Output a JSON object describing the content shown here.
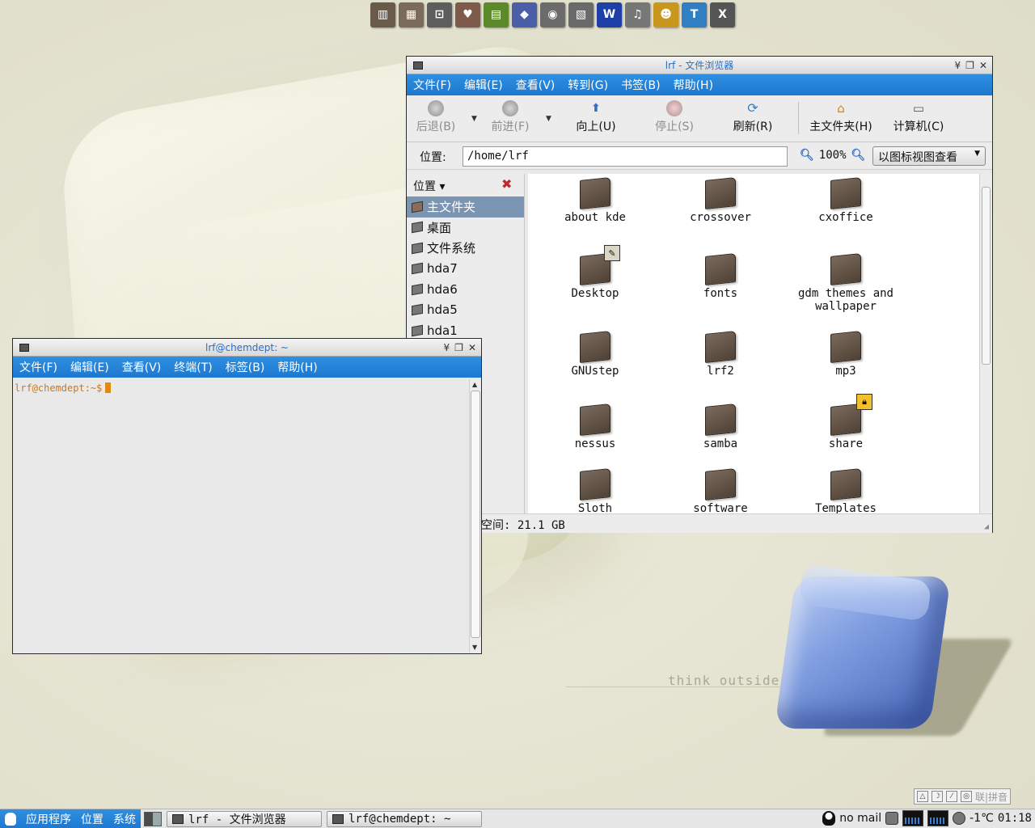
{
  "desktop": {
    "slogan": "think outside"
  },
  "launcher": [
    {
      "icon": "file-manager-icon",
      "glyph": "▥",
      "color": "#6a5a4a"
    },
    {
      "icon": "documents-icon",
      "glyph": "▦",
      "color": "#7b6b5b"
    },
    {
      "icon": "display-settings-icon",
      "glyph": "⊡",
      "color": "#5d5d5d"
    },
    {
      "icon": "favorites-folder-icon",
      "glyph": "♥",
      "color": "#7d5a4a"
    },
    {
      "icon": "dictionary-book-icon",
      "glyph": "▤",
      "color": "#5c8a2a"
    },
    {
      "icon": "education-icon",
      "glyph": "◆",
      "color": "#4b5fa8"
    },
    {
      "icon": "gimp-icon",
      "glyph": "◉",
      "color": "#6b6b6b"
    },
    {
      "icon": "video-film-icon",
      "glyph": "▧",
      "color": "#6a6a6a"
    },
    {
      "icon": "word-processor-icon",
      "glyph": "W",
      "color": "#1e3fa8"
    },
    {
      "icon": "music-notes-icon",
      "glyph": "♫",
      "color": "#777777"
    },
    {
      "icon": "user-person-icon",
      "glyph": "☻",
      "color": "#c9961e"
    },
    {
      "icon": "terminal-term-icon",
      "glyph": "T",
      "color": "#2f7fc2"
    },
    {
      "icon": "x-window-icon",
      "glyph": "X",
      "color": "#555555"
    }
  ],
  "file_browser": {
    "title": "lrf - 文件浏览器",
    "menu": [
      "文件(F)",
      "编辑(E)",
      "查看(V)",
      "转到(G)",
      "书签(B)",
      "帮助(H)"
    ],
    "toolbar": {
      "back": "后退(B)",
      "forward": "前进(F)",
      "up": "向上(U)",
      "stop": "停止(S)",
      "reload": "刷新(R)",
      "home": "主文件夹(H)",
      "computer": "计算机(C)"
    },
    "location_label": "位置:",
    "location_value": "/home/lrf",
    "zoom": "100%",
    "view_mode": "以图标视图查看",
    "sidebar": {
      "header": "位置",
      "items": [
        "主文件夹",
        "桌面",
        "文件系统",
        "hda7",
        "hda6",
        "hda5",
        "hda1"
      ]
    },
    "folders": [
      {
        "name": "about kde"
      },
      {
        "name": "crossover"
      },
      {
        "name": "cxoffice"
      },
      {
        "name": "Desktop"
      },
      {
        "name": "fonts"
      },
      {
        "name": "gdm themes and wallpaper"
      },
      {
        "name": "GNUstep"
      },
      {
        "name": "lrf2"
      },
      {
        "name": "mp3"
      },
      {
        "name": "nessus"
      },
      {
        "name": "samba"
      },
      {
        "name": "share"
      },
      {
        "name": "Sloth"
      },
      {
        "name": "software"
      },
      {
        "name": "Templates"
      }
    ],
    "status": "空间: 21.1 GB"
  },
  "terminal": {
    "title": "lrf@chemdept: ~",
    "menu": [
      "文件(F)",
      "编辑(E)",
      "查看(V)",
      "终端(T)",
      "标签(B)",
      "帮助(H)"
    ],
    "prompt": "lrf@chemdept:~$"
  },
  "ime": {
    "label": "联|拼音"
  },
  "panel": {
    "apps": "应用程序",
    "places": "位置",
    "system": "系统",
    "tasks": [
      "lrf - 文件浏览器",
      "lrf@chemdept: ~"
    ],
    "mail": "no mail",
    "weather": "-1℃",
    "time": "01:18"
  }
}
